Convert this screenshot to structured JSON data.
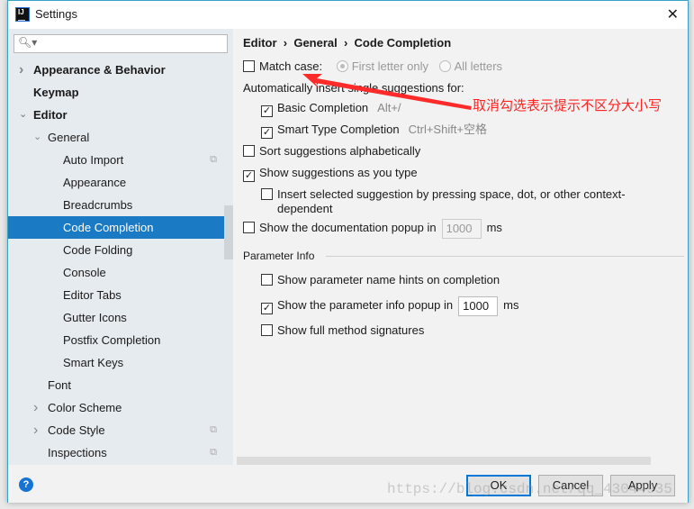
{
  "window": {
    "title": "Settings",
    "logo_text": "IJ"
  },
  "search": {
    "placeholder": ""
  },
  "tree": [
    {
      "label": "Appearance & Behavior",
      "level": 0,
      "expand": "collapsed",
      "bold": true
    },
    {
      "label": "Keymap",
      "level": 0,
      "bold": true
    },
    {
      "label": "Editor",
      "level": 0,
      "expand": "expanded",
      "bold": true
    },
    {
      "label": "General",
      "level": 1,
      "expand": "expanded"
    },
    {
      "label": "Auto Import",
      "level": 2,
      "copy": true
    },
    {
      "label": "Appearance",
      "level": 2
    },
    {
      "label": "Breadcrumbs",
      "level": 2
    },
    {
      "label": "Code Completion",
      "level": 2,
      "selected": true
    },
    {
      "label": "Code Folding",
      "level": 2
    },
    {
      "label": "Console",
      "level": 2
    },
    {
      "label": "Editor Tabs",
      "level": 2
    },
    {
      "label": "Gutter Icons",
      "level": 2
    },
    {
      "label": "Postfix Completion",
      "level": 2
    },
    {
      "label": "Smart Keys",
      "level": 2
    },
    {
      "label": "Font",
      "level": 1
    },
    {
      "label": "Color Scheme",
      "level": 1,
      "expand": "collapsed"
    },
    {
      "label": "Code Style",
      "level": 1,
      "expand": "collapsed",
      "copy": true
    },
    {
      "label": "Inspections",
      "level": 1,
      "copy": true
    }
  ],
  "breadcrumb": [
    "Editor",
    "General",
    "Code Completion"
  ],
  "options": {
    "match_case": {
      "label": "Match case:",
      "checked": false
    },
    "first_letter": {
      "label": "First letter only",
      "selected": true
    },
    "all_letters": {
      "label": "All letters",
      "selected": false
    },
    "auto_insert_label": "Automatically insert single suggestions for:",
    "basic": {
      "label": "Basic Completion",
      "shortcut": "Alt+/",
      "checked": true
    },
    "smart": {
      "label": "Smart Type Completion",
      "shortcut": "Ctrl+Shift+空格",
      "checked": true
    },
    "sort": {
      "label": "Sort suggestions alphabetically",
      "checked": false
    },
    "show_as_type": {
      "label": "Show suggestions as you type",
      "checked": true
    },
    "insert_selected": {
      "label": "Insert selected suggestion by pressing space, dot, or other context-dependent",
      "checked": false
    },
    "doc_popup": {
      "label": "Show the documentation popup in",
      "value": "1000",
      "unit": "ms",
      "checked": false
    }
  },
  "param_info": {
    "title": "Parameter Info",
    "hints": {
      "label": "Show parameter name hints on completion",
      "checked": false
    },
    "popup": {
      "label": "Show the parameter info popup in",
      "value": "1000",
      "unit": "ms",
      "checked": true
    },
    "full_sig": {
      "label": "Show full method signatures",
      "checked": false
    }
  },
  "annotation": "取消勾选表示提示不区分大小写",
  "annotation_color": "#ff2222",
  "buttons": {
    "ok": "OK",
    "cancel": "Cancel",
    "apply": "Apply",
    "help": "?"
  },
  "watermark": "https://blog.csdn.net/qq_43044935",
  "colors": {
    "selection": "#1a7ac4",
    "sidebar": "#e6ebf0",
    "panel": "#f2f2f2"
  }
}
